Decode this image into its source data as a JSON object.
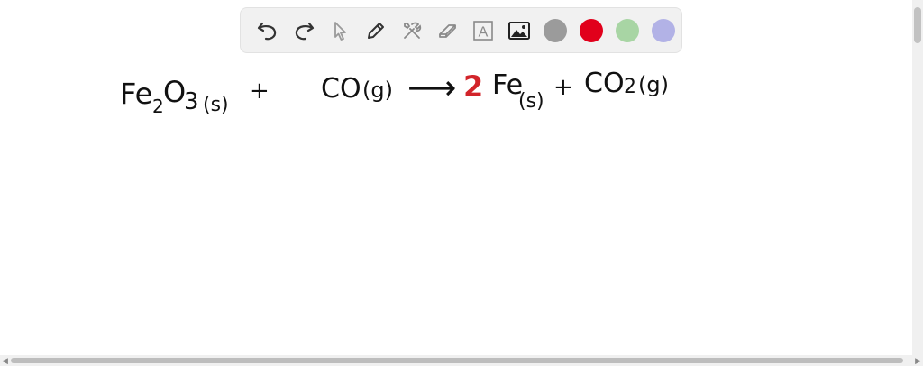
{
  "toolbar": {
    "tools": [
      {
        "name": "undo-icon"
      },
      {
        "name": "redo-icon"
      },
      {
        "name": "pointer-icon"
      },
      {
        "name": "pencil-icon"
      },
      {
        "name": "tools-icon"
      },
      {
        "name": "eraser-icon"
      },
      {
        "name": "text-icon",
        "glyph": "A"
      },
      {
        "name": "image-icon"
      }
    ],
    "colors": [
      "#9b9b9b",
      "#e1001b",
      "#a8d5a4",
      "#b2b2e6"
    ]
  },
  "equation": {
    "fe2o3": "Fe",
    "fe2o3_sub": "2",
    "fe2o3_o": "O",
    "fe2o3_3": "3",
    "fe2o3_state": "(s)",
    "plus1": "+",
    "co": "CO",
    "co_state": "(g)",
    "arrow": "⟶",
    "coef": "2",
    "fe": "Fe",
    "fe_state": "(s)",
    "plus2": "+",
    "co2": "CO",
    "co2_sub": "2",
    "co2_state": "(g)"
  }
}
